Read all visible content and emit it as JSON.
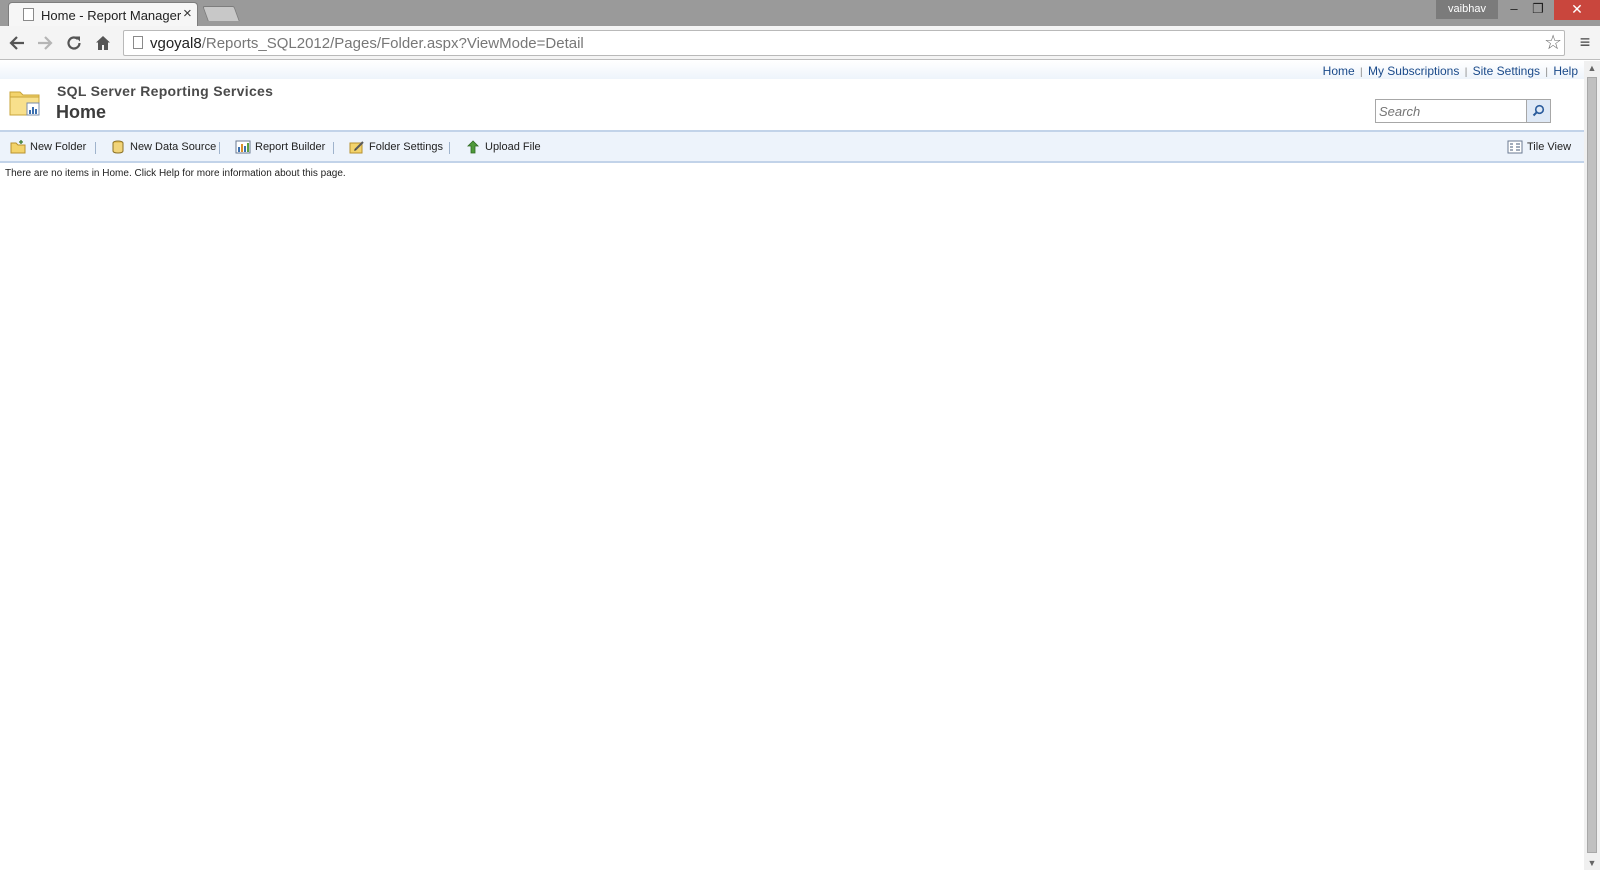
{
  "browser": {
    "tab_title": "Home - Report Manager",
    "tab_close": "×",
    "user_name": "vaibhav",
    "window_minimize": "–",
    "window_maximize": "❐",
    "window_close": "✕",
    "url_host": "vgoyal8",
    "url_path": "/Reports_SQL2012/Pages/Folder.aspx?ViewMode=Detail"
  },
  "global_nav": {
    "home": "Home",
    "subscriptions": "My Subscriptions",
    "site_settings": "Site Settings",
    "help": "Help",
    "separator": "|"
  },
  "header": {
    "app_title": "SQL Server Reporting Services",
    "page_title": "Home",
    "search_placeholder": "Search"
  },
  "toolbar": {
    "new_folder": "New Folder",
    "new_data_source": "New Data Source",
    "report_builder": "Report Builder",
    "folder_settings": "Folder Settings",
    "upload_file": "Upload File",
    "tile_view": "Tile View"
  },
  "content": {
    "empty_message": "There are no items in Home. Click Help for more information about this page."
  }
}
